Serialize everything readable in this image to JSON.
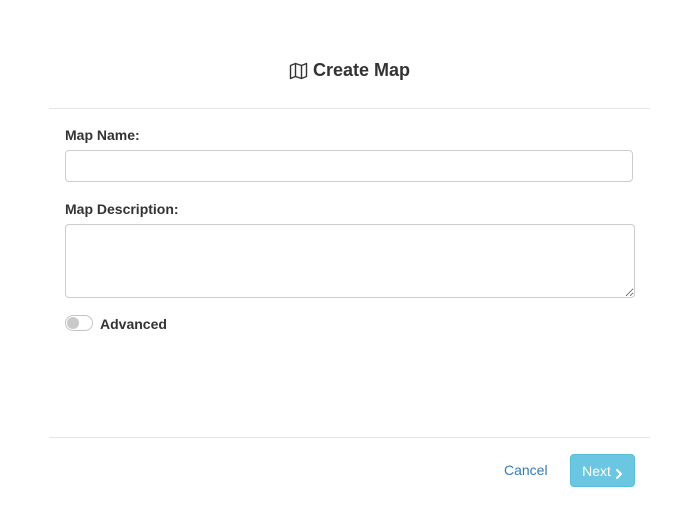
{
  "dialog": {
    "title": "Create Map",
    "title_icon": "map-icon"
  },
  "form": {
    "map_name": {
      "label": "Map Name:",
      "value": "",
      "placeholder": ""
    },
    "map_description": {
      "label": "Map Description:",
      "value": "",
      "placeholder": ""
    },
    "advanced": {
      "label": "Advanced",
      "enabled": false
    }
  },
  "footer": {
    "cancel_label": "Cancel",
    "next_label": "Next",
    "next_icon": "chevron-right-icon"
  },
  "colors": {
    "primary_link": "#337ab7",
    "info_button": "#5bc0de",
    "divider": "#e5e5e5"
  }
}
